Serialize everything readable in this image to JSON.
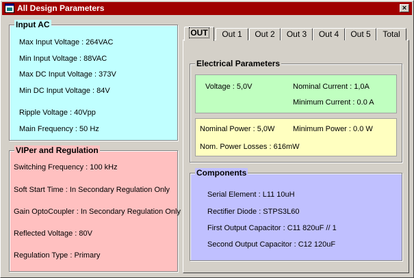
{
  "window": {
    "title": "All Design Parameters",
    "close_label": "×"
  },
  "input_ac": {
    "legend": "Input AC",
    "lines": [
      "Max Input Voltage : 264VAC",
      "Min Input Voltage : 88VAC",
      "Max DC Input Voltage : 373V",
      "Min DC Input Voltage : 84V",
      "Ripple Voltage : 40Vpp",
      "Main Frequency : 50 Hz"
    ]
  },
  "viper": {
    "legend": "VIPer and Regulation",
    "lines": [
      "Switching Frequency : 100 kHz",
      "Soft Start Time : In Secondary Regulation Only",
      "Gain OptoCoupler :  In Secondary Regulation Only",
      "Reflected Voltage : 80V",
      "Regulation Type : Primary"
    ]
  },
  "tabs": [
    "OUT",
    "Out 1",
    "Out 2",
    "Out 3",
    "Out 4",
    "Out 5",
    "Total"
  ],
  "electrical": {
    "legend": "Electrical Parameters",
    "voltage": "Voltage : 5,0V",
    "nominal_current": "Nominal Current : 1,0A",
    "minimum_current": "Minimum Current : 0.0 A",
    "nominal_power": "Nominal Power : 5,0W",
    "minimum_power": "Minimum Power : 0.0 W",
    "power_losses": "Nom. Power Losses : 616mW"
  },
  "components": {
    "legend": "Components",
    "lines": [
      "Serial Element : L11  10uH",
      "Rectifier Diode : STPS3L60",
      "First Output Capacitor : C11 820uF  //  1",
      "Second Output Capacitor : C12 120uF"
    ]
  },
  "colors": {
    "titlebar": "#a00000",
    "input_ac_bg": "#c0ffff",
    "viper_bg": "#ffc0c0",
    "electrical_top_bg": "#c0ffc0",
    "electrical_bottom_bg": "#ffffc0",
    "components_bg": "#c0c0ff"
  },
  "icons": {
    "app": "app-window-icon",
    "close": "close-icon"
  }
}
